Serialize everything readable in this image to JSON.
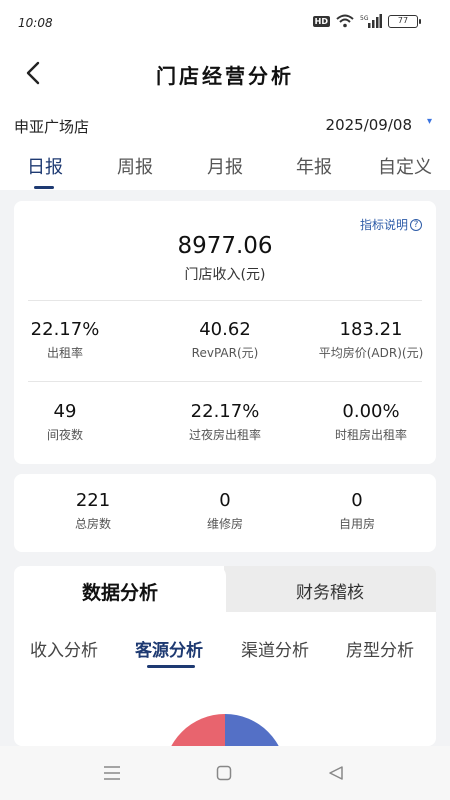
{
  "status": {
    "time": "10:08",
    "hd": "HD",
    "signal": "5G",
    "battery": "77"
  },
  "header": {
    "title": "门店经营分析"
  },
  "store": {
    "name": "申亚广场店",
    "date": "2025/09/08"
  },
  "period_tabs": [
    {
      "label": "日报",
      "active": true
    },
    {
      "label": "周报"
    },
    {
      "label": "月报"
    },
    {
      "label": "年报"
    },
    {
      "label": "自定义"
    }
  ],
  "summary": {
    "indicator_link": "指标说明",
    "revenue_value": "8977.06",
    "revenue_label": "门店收入(元)",
    "metrics": [
      {
        "value": "22.17%",
        "label": "出租率"
      },
      {
        "value": "40.62",
        "label": "RevPAR(元)"
      },
      {
        "value": "183.21",
        "label": "平均房价(ADR)(元)"
      },
      {
        "value": "49",
        "label": "间夜数"
      },
      {
        "value": "22.17%",
        "label": "过夜房出租率"
      },
      {
        "value": "0.00%",
        "label": "时租房出租率"
      }
    ]
  },
  "rooms": [
    {
      "value": "221",
      "label": "总房数"
    },
    {
      "value": "0",
      "label": "维修房"
    },
    {
      "value": "0",
      "label": "自用房"
    }
  ],
  "analysis": {
    "segments": {
      "left": "数据分析",
      "right": "财务稽核"
    },
    "sub_tabs": [
      {
        "label": "收入分析"
      },
      {
        "label": "客源分析",
        "active": true
      },
      {
        "label": "渠道分析"
      },
      {
        "label": "房型分析"
      }
    ],
    "pie_colors": {
      "left": "#e8646e",
      "right": "#5470c6"
    }
  }
}
